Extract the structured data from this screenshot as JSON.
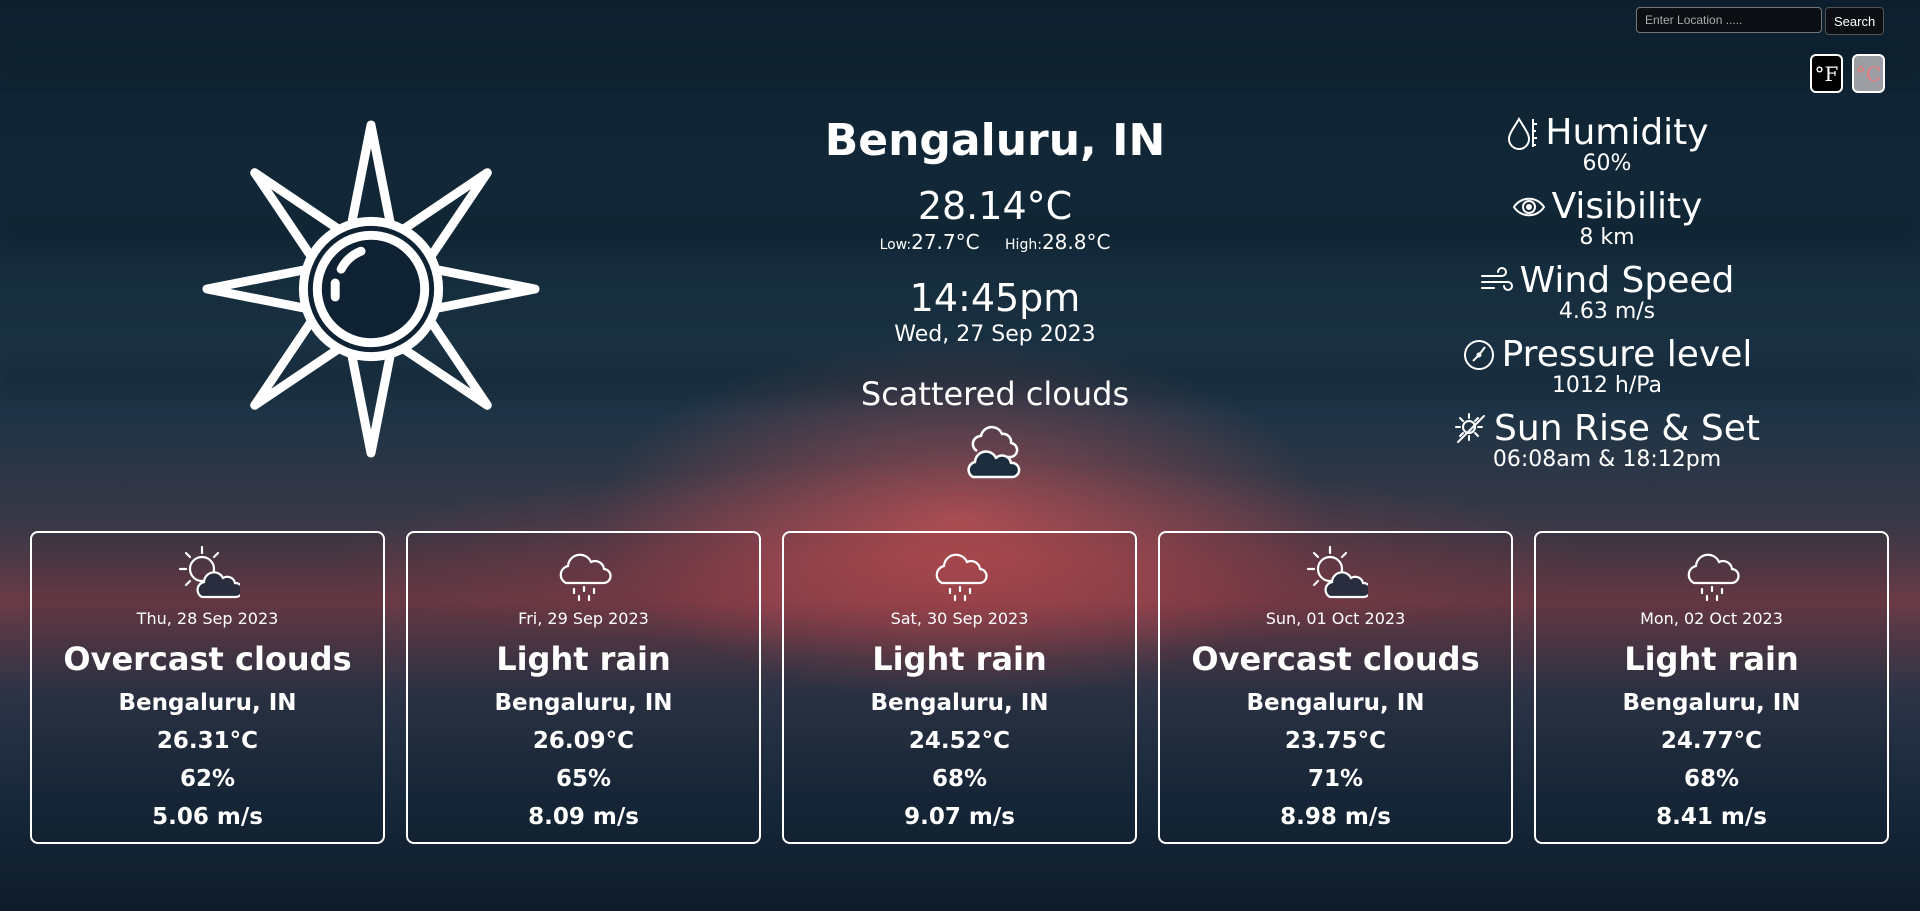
{
  "search": {
    "placeholder": "Enter Location .....",
    "button_label": "Search"
  },
  "units": {
    "fahrenheit_label": "°F",
    "celsius_label": "°C"
  },
  "current": {
    "city": "Bengaluru, IN",
    "temp": "28.14°C",
    "low_label": "Low:",
    "low": "27.7°C",
    "high_label": "High:",
    "high": "28.8°C",
    "time": "14:45pm",
    "date": "Wed, 27 Sep 2023",
    "description": "Scattered clouds",
    "main_icon": "sun-icon",
    "desc_icon": "clouds-icon"
  },
  "stats": [
    {
      "icon": "humidity-icon",
      "label": "Humidity",
      "value": "60%"
    },
    {
      "icon": "eye-icon",
      "label": "Visibility",
      "value": "8 km"
    },
    {
      "icon": "wind-icon",
      "label": "Wind Speed",
      "value": "4.63 m/s"
    },
    {
      "icon": "compass-icon",
      "label": "Pressure level",
      "value": "1012 h/Pa"
    },
    {
      "icon": "sunrise-icon",
      "label": "Sun Rise & Set",
      "value": "06:08am & 18:12pm"
    }
  ],
  "forecast": [
    {
      "icon": "sun-cloud-icon",
      "date": "Thu, 28 Sep 2023",
      "description": "Overcast clouds",
      "city": "Bengaluru, IN",
      "temp": "26.31°C",
      "humidity": "62%",
      "wind": "5.06 m/s"
    },
    {
      "icon": "rain-cloud-icon",
      "date": "Fri, 29 Sep 2023",
      "description": "Light rain",
      "city": "Bengaluru, IN",
      "temp": "26.09°C",
      "humidity": "65%",
      "wind": "8.09 m/s"
    },
    {
      "icon": "rain-cloud-icon",
      "date": "Sat, 30 Sep 2023",
      "description": "Light rain",
      "city": "Bengaluru, IN",
      "temp": "24.52°C",
      "humidity": "68%",
      "wind": "9.07 m/s"
    },
    {
      "icon": "sun-cloud-icon",
      "date": "Sun, 01 Oct 2023",
      "description": "Overcast clouds",
      "city": "Bengaluru, IN",
      "temp": "23.75°C",
      "humidity": "71%",
      "wind": "8.98 m/s"
    },
    {
      "icon": "rain-cloud-icon",
      "date": "Mon, 02 Oct 2023",
      "description": "Light rain",
      "city": "Bengaluru, IN",
      "temp": "24.77°C",
      "humidity": "68%",
      "wind": "8.41 m/s"
    }
  ]
}
